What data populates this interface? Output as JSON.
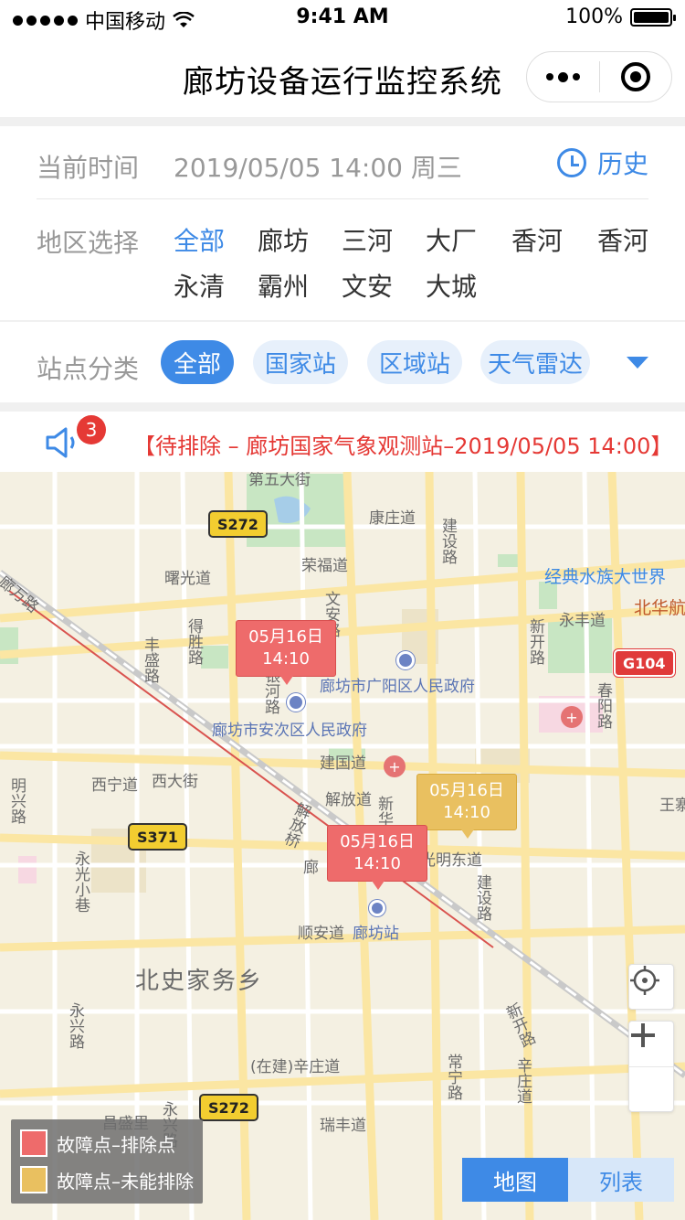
{
  "status_bar": {
    "carrier": "中国移动",
    "time": "9:41 AM",
    "battery": "100%"
  },
  "nav": {
    "title": "廊坊设备运行监控系统"
  },
  "time_row": {
    "label": "当前时间",
    "value": "2019/05/05 14:00 周三",
    "history_label": "历史"
  },
  "region_row": {
    "label": "地区选择",
    "items": [
      "全部",
      "廊坊",
      "三河",
      "大厂",
      "香河",
      "香河",
      "永清",
      "霸州",
      "文安",
      "大城"
    ],
    "selected": "全部"
  },
  "station_row": {
    "label": "站点分类",
    "chips": [
      "全部",
      "国家站",
      "区域站",
      "天气雷达"
    ],
    "selected": "全部"
  },
  "alert": {
    "count": "3",
    "text": "【待排除 – 廊坊国家气象观测站–2019/05/05 14:00】"
  },
  "map": {
    "roads": [
      "第五大街",
      "康庄道",
      "荣福道",
      "曙光道",
      "经典水族大世界",
      "北华航",
      "永丰道",
      "建设路",
      "文安路",
      "新开路",
      "丰盛路",
      "得胜路",
      "银河路",
      "廊坊市广阳区人民政府",
      "廊坊市安次区人民政府",
      "建国道",
      "西宁道",
      "西大街",
      "解放道",
      "解放桥",
      "新华路",
      "光明东道",
      "建设路",
      "春阳路",
      "王寨",
      "明兴路",
      "永光小巷",
      "顺安道",
      "廊坊站",
      "北史家务乡",
      "永兴路",
      "(在建)辛庄道",
      "常宁路",
      "新开路",
      "辛庄道",
      "昌盛里",
      "瑞丰道",
      "永兴路",
      "廊万路",
      "廊"
    ],
    "shields": [
      "S272",
      "G104",
      "S371",
      "S272"
    ],
    "markers": [
      {
        "date": "05月16日",
        "time": "14:10",
        "status": "red"
      },
      {
        "date": "05月16日",
        "time": "14:10",
        "status": "yellow"
      },
      {
        "date": "05月16日",
        "time": "14:10",
        "status": "red"
      }
    ],
    "legend": [
      {
        "label": "故障点–排除点",
        "color": "#ee6b6b"
      },
      {
        "label": "故障点–未能排除",
        "color": "#e9c060"
      }
    ],
    "view_toggle": {
      "map": "地图",
      "list": "列表",
      "active": "map"
    }
  }
}
